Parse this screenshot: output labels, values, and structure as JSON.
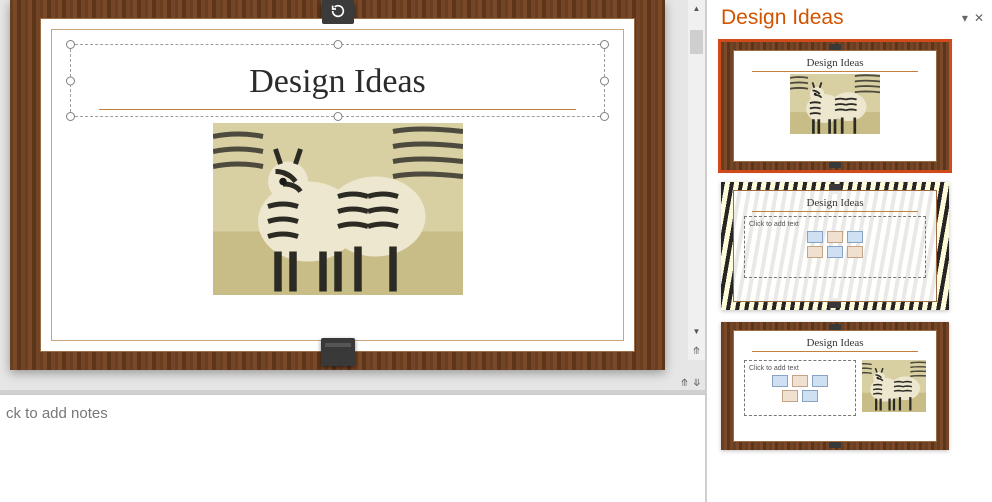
{
  "pane": {
    "title": "Design Ideas",
    "dropdown_glyph": "▾",
    "close_glyph": "✕"
  },
  "slide": {
    "title": "Design Ideas"
  },
  "notes": {
    "placeholder": "ck to add notes"
  },
  "ideas": [
    {
      "title": "Design Ideas",
      "selected": true,
      "layout": "photo"
    },
    {
      "title": "Design Ideas",
      "selected": false,
      "layout": "zebrabg",
      "cta": "Click to add text"
    },
    {
      "title": "Design Ideas",
      "selected": false,
      "layout": "split",
      "cta": "Click to add text"
    }
  ]
}
